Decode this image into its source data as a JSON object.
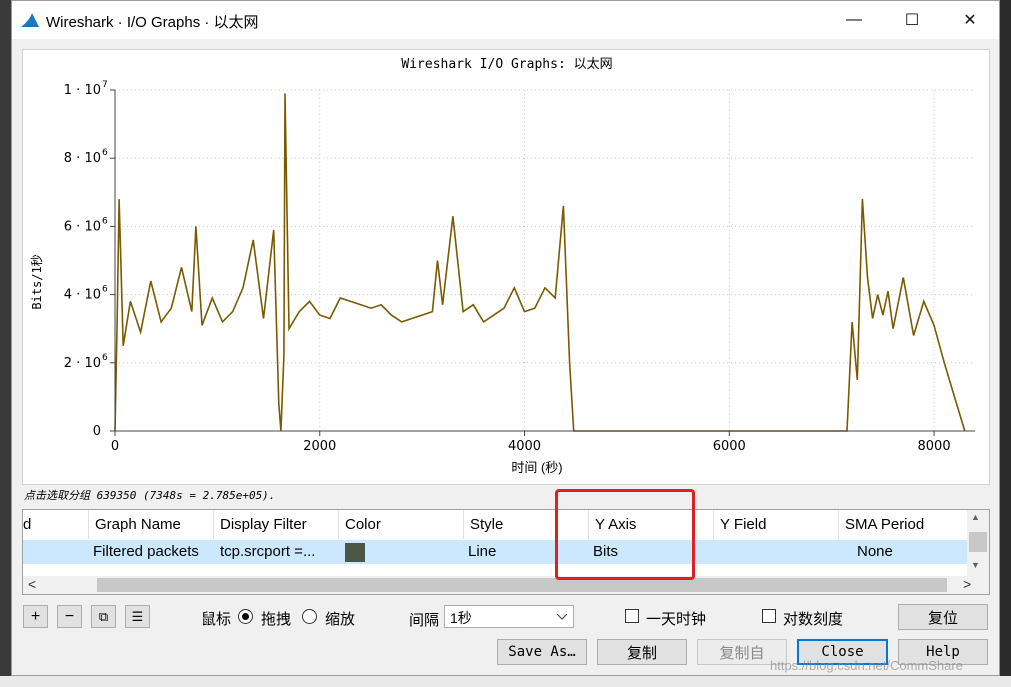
{
  "window": {
    "title": "Wireshark · I/O Graphs · 以太网",
    "minimize_glyph": "—",
    "maximize_glyph": "☐",
    "close_glyph": "✕"
  },
  "chart_data": {
    "type": "line",
    "title": "Wireshark I/O Graphs: 以太网",
    "xlabel": "时间 (秒)",
    "ylabel": "Bits/1秒",
    "xlim": [
      0,
      8400
    ],
    "ylim": [
      0,
      10000000
    ],
    "x_ticks": [
      0,
      2000,
      4000,
      6000,
      8000
    ],
    "y_ticks": [
      {
        "value": 0,
        "label": "0",
        "exp": ""
      },
      {
        "value": 2000000,
        "label": "2 · 10",
        "exp": "6"
      },
      {
        "value": 4000000,
        "label": "4 · 10",
        "exp": "6"
      },
      {
        "value": 6000000,
        "label": "6 · 10",
        "exp": "6"
      },
      {
        "value": 8000000,
        "label": "8 · 10",
        "exp": "6"
      },
      {
        "value": 10000000,
        "label": "1 · 10",
        "exp": "7"
      }
    ],
    "grid": true,
    "series": [
      {
        "color": "#7a5a00",
        "x": [
          0,
          20,
          40,
          80,
          150,
          250,
          350,
          450,
          550,
          650,
          750,
          790,
          850,
          950,
          1050,
          1150,
          1250,
          1350,
          1450,
          1550,
          1600,
          1620,
          1650,
          1660,
          1700,
          1800,
          1900,
          2000,
          2100,
          2200,
          2300,
          2400,
          2500,
          2600,
          2700,
          2800,
          2900,
          3000,
          3100,
          3150,
          3200,
          3300,
          3400,
          3500,
          3600,
          3700,
          3800,
          3900,
          4000,
          4100,
          4200,
          4300,
          4380,
          4440,
          4480,
          4520,
          5000,
          6000,
          7000,
          7150,
          7200,
          7250,
          7300,
          7350,
          7400,
          7450,
          7500,
          7550,
          7600,
          7700,
          7800,
          7900,
          8000,
          8100,
          8200,
          8300
        ],
        "y": [
          0,
          3000000,
          6800000,
          2500000,
          3800000,
          2900000,
          4400000,
          3200000,
          3600000,
          4800000,
          3500000,
          6000000,
          3100000,
          3900000,
          3200000,
          3500000,
          4200000,
          5600000,
          3300000,
          5900000,
          800000,
          0,
          2200000,
          9900000,
          3000000,
          3500000,
          3800000,
          3400000,
          3300000,
          3900000,
          3800000,
          3700000,
          3600000,
          3700000,
          3400000,
          3200000,
          3300000,
          3400000,
          3500000,
          5000000,
          3700000,
          6300000,
          3500000,
          3700000,
          3200000,
          3400000,
          3600000,
          4200000,
          3500000,
          3600000,
          4200000,
          3900000,
          6600000,
          2000000,
          0,
          0,
          0,
          0,
          0,
          0,
          3200000,
          1500000,
          6800000,
          4500000,
          3300000,
          4000000,
          3400000,
          4100000,
          3000000,
          4500000,
          2800000,
          3800000,
          3100000,
          2000000,
          1000000,
          0
        ]
      }
    ]
  },
  "status_text": "点击选取分组 639350 (7348s = 2.785e+05).",
  "table": {
    "columns": [
      "d",
      "Graph Name",
      "Display Filter",
      "Color",
      "Style",
      "Y Axis",
      "Y Field",
      "SMA Period"
    ],
    "row": {
      "graph_name": "Filtered packets",
      "display_filter": "tcp.srcport =...",
      "color": "#4b5646",
      "style": "Line",
      "y_axis": "Bits",
      "y_field": "",
      "sma_period": "None"
    },
    "vscroll_up_glyph": "▲",
    "vscroll_down_glyph": "▼",
    "hscroll_left_glyph": "<",
    "hscroll_right_glyph": ">"
  },
  "controls": {
    "add_glyph": "+",
    "remove_glyph": "−",
    "copy_glyph": "⧉",
    "clear_glyph": "☰",
    "mouse_label": "鼠标",
    "drag_label": "拖拽",
    "zoom_label": "缩放",
    "interval_label": "间隔",
    "interval_value": "1秒",
    "time_of_day_label": "一天时钟",
    "log_scale_label": "对数刻度",
    "reset_label": "复位"
  },
  "buttons": {
    "save_as": "Save As…",
    "copy": "复制",
    "copy_from": "复制自",
    "close": "Close",
    "help": "Help"
  },
  "watermark": "https://blog.csdn.net/CommShare"
}
